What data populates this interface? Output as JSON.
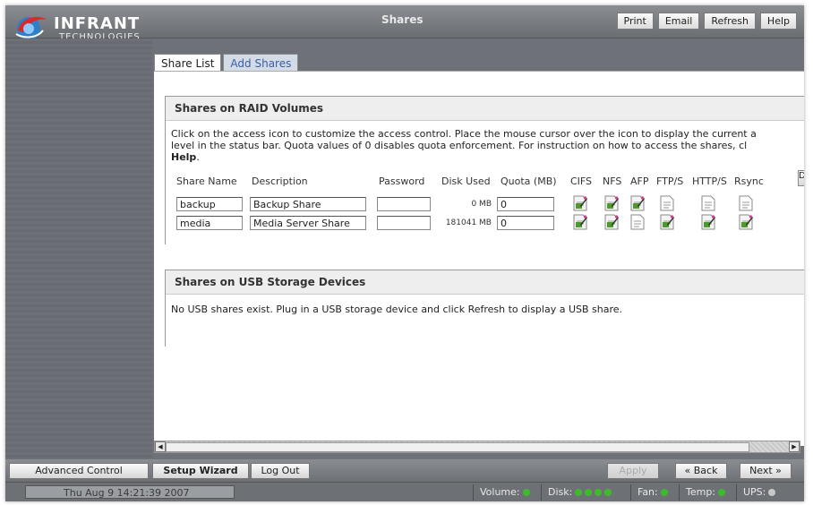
{
  "app": {
    "brand": "INFRANT",
    "brand_sub": "TECHNOLOGIES",
    "title": "Shares",
    "top_buttons": [
      "Print",
      "Email",
      "Refresh",
      "Help"
    ]
  },
  "tabs": [
    {
      "label": "Share List",
      "active": true
    },
    {
      "label": "Add Shares",
      "active": false
    }
  ],
  "raid": {
    "heading": "Shares on RAID Volumes",
    "text_line1": "Click on the access icon to customize the access control. Place the mouse cursor over the icon to display the current a",
    "text_line2": "level in the status bar. Quota values of 0 disables quota enforcement. For instruction on how to access the shares, cl",
    "text_bold": "Help",
    "text_end": ".",
    "columns": [
      "Share Name",
      "Description",
      "Password",
      "Disk Used",
      "Quota (MB)",
      "CIFS",
      "NFS",
      "AFP",
      "FTP/S",
      "HTTP/S",
      "Rsync"
    ],
    "extra_button": "D",
    "rows": [
      {
        "name": "backup",
        "description": "Backup Share",
        "password": "",
        "disk_used": "0 MB",
        "quota": "0",
        "access": [
          "enabled",
          "enabled",
          "enabled",
          "disabled",
          "disabled",
          "disabled"
        ]
      },
      {
        "name": "media",
        "description": "Media Server Share",
        "password": "",
        "disk_used": "181041 MB",
        "quota": "0",
        "access": [
          "enabled",
          "enabled",
          "disabled",
          "enabled",
          "enabled",
          "enabled"
        ]
      }
    ]
  },
  "usb": {
    "heading": "Shares on USB Storage Devices",
    "text": "No USB shares exist. Plug in a USB storage device and click Refresh to display a USB share."
  },
  "bottom": {
    "advanced": "Advanced Control",
    "wizard": "Setup Wizard",
    "logout": "Log Out",
    "apply": "Apply",
    "back": "« Back",
    "next": "Next »"
  },
  "status": {
    "datetime": "Thu Aug  9 14:21:39 2007",
    "volume": "Volume:",
    "disk": "Disk:",
    "fan": "Fan:",
    "temp": "Temp:",
    "ups": "UPS:"
  },
  "colors": {
    "ok": "#3dbb2c",
    "off": "#c9c9c9",
    "tab_link": "#3a5ea5"
  }
}
